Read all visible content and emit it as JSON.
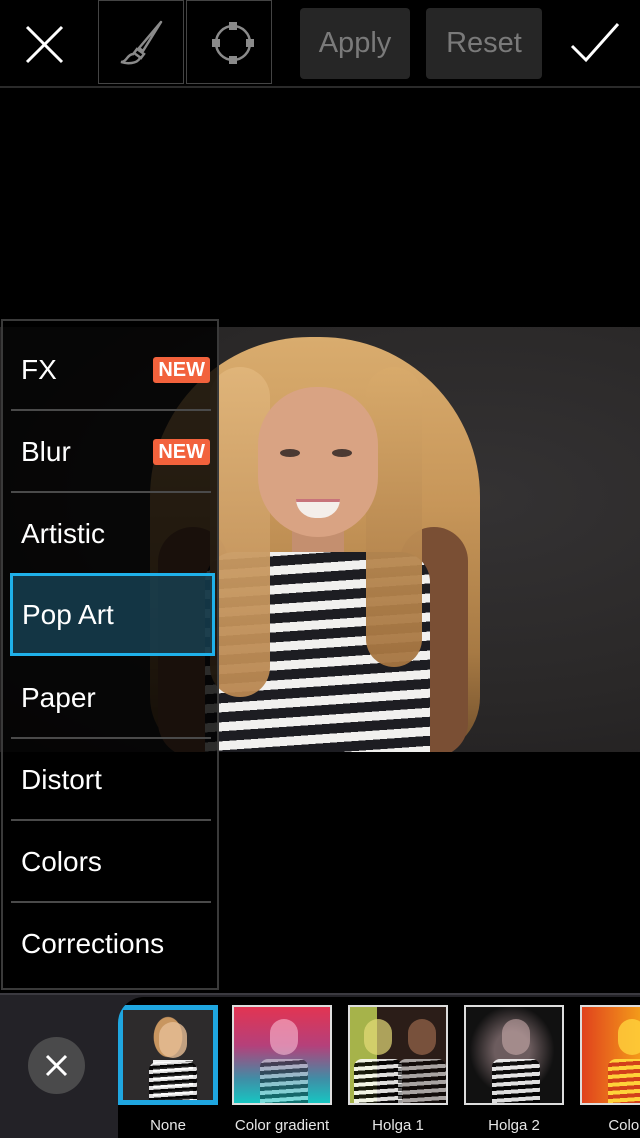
{
  "toolbar": {
    "close_icon": "close-x-icon",
    "brush_icon": "paintbrush-icon",
    "shape_icon": "circle-selection-icon",
    "apply_label": "Apply",
    "reset_label": "Reset",
    "done_icon": "checkmark-icon"
  },
  "colors": {
    "accent": "#1fb1ea",
    "badge": "#f2623c",
    "button_bg": "#262626",
    "button_text": "#7a7a7a"
  },
  "menu": {
    "items": [
      {
        "label": "FX",
        "badge": "NEW"
      },
      {
        "label": "Blur",
        "badge": "NEW"
      },
      {
        "label": "Artistic"
      },
      {
        "label": "Pop Art",
        "selected": true
      },
      {
        "label": "Paper"
      },
      {
        "label": "Distort"
      },
      {
        "label": "Colors"
      },
      {
        "label": "Corrections"
      }
    ]
  },
  "effects": {
    "close_icon": "close-x-icon",
    "items": [
      {
        "label": "None",
        "selected": true
      },
      {
        "label": "Color gradient"
      },
      {
        "label": "Holga 1"
      },
      {
        "label": "Holga 2"
      },
      {
        "label": "Colors"
      }
    ]
  }
}
